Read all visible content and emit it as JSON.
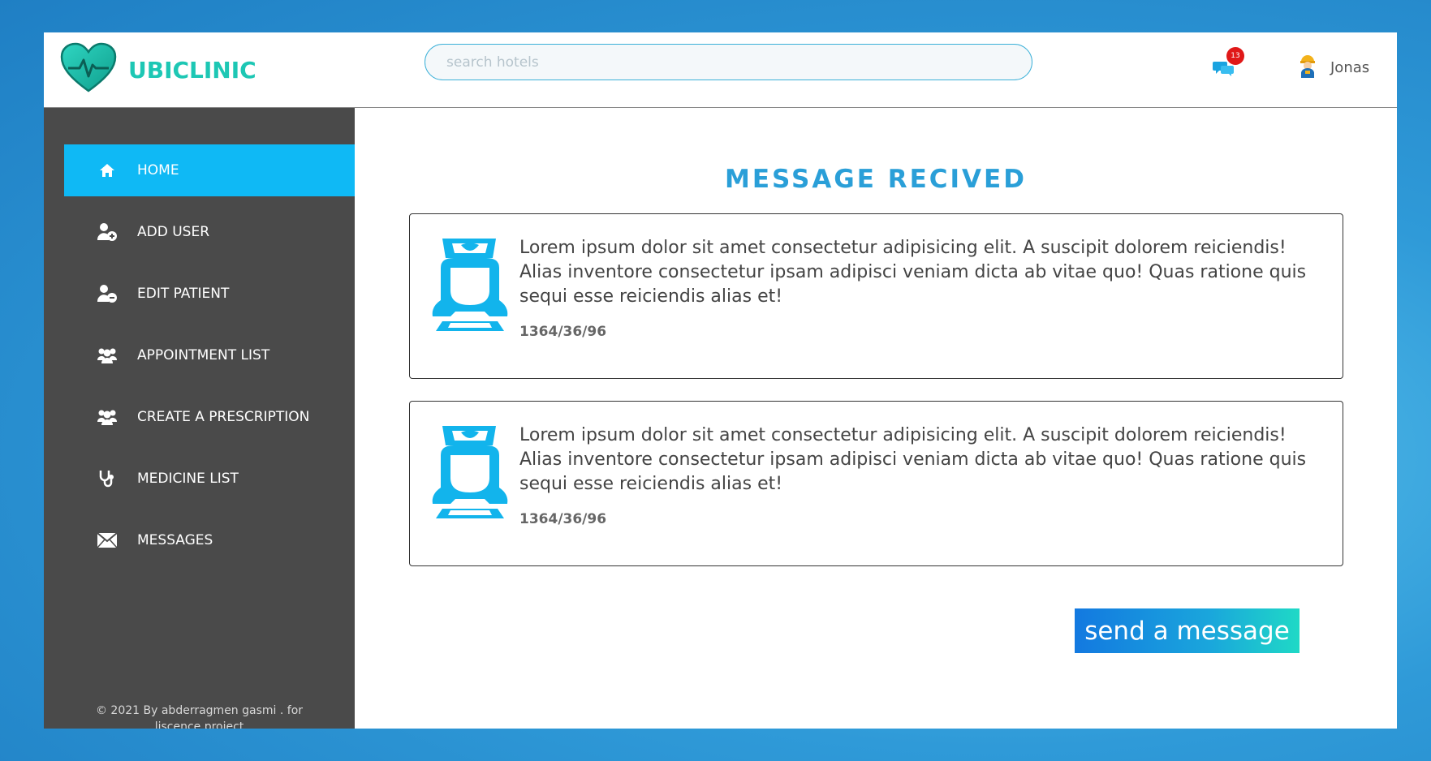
{
  "brand": {
    "name": "UBICLINIC",
    "logo_icon": "heart-pulse-icon",
    "color": "#1dc7b4"
  },
  "header": {
    "search_placeholder": "search hotels",
    "notification_count": "13",
    "notification_icon": "chat-bubbles-icon",
    "user_name": "Jonas",
    "user_avatar_icon": "worker-avatar-icon"
  },
  "sidebar": {
    "items": [
      {
        "label": "HOME",
        "icon": "home-icon",
        "active": true
      },
      {
        "label": "ADD USER",
        "icon": "user-add-icon"
      },
      {
        "label": "EDIT PATIENT",
        "icon": "user-remove-icon"
      },
      {
        "label": "APPOINTMENT LIST",
        "icon": "users-group-icon"
      },
      {
        "label": "CREATE A PRESCRIPTION",
        "icon": "users-group-icon"
      },
      {
        "label": "MEDICINE LIST",
        "icon": "stethoscope-icon"
      },
      {
        "label": "MESSAGES",
        "icon": "envelope-icon"
      }
    ],
    "footer_line1": "© 2021 By abderragmen gasmi . for",
    "footer_line2": "liscence project"
  },
  "main": {
    "title": "MESSAGE RECIVED",
    "messages": [
      {
        "avatar_icon": "nurse-icon",
        "text": "Lorem ipsum dolor sit amet consectetur adipisicing elit. A suscipit dolorem reiciendis! Alias inventore consectetur ipsam adipisci veniam dicta ab vitae quo! Quas ratione quis sequi esse reiciendis alias et!",
        "date": "1364/36/96"
      },
      {
        "avatar_icon": "nurse-icon",
        "text": "Lorem ipsum dolor sit amet consectetur adipisicing elit. A suscipit dolorem reiciendis! Alias inventore consectetur ipsam adipisci veniam dicta ab vitae quo! Quas ratione quis sequi esse reiciendis alias et!",
        "date": "1364/36/96"
      }
    ],
    "send_button_label": "send a message"
  },
  "colors": {
    "accent": "#0fb9f5",
    "title": "#2a9fd8",
    "sidebar_bg": "#4a4a4a",
    "badge": "#e01818"
  }
}
